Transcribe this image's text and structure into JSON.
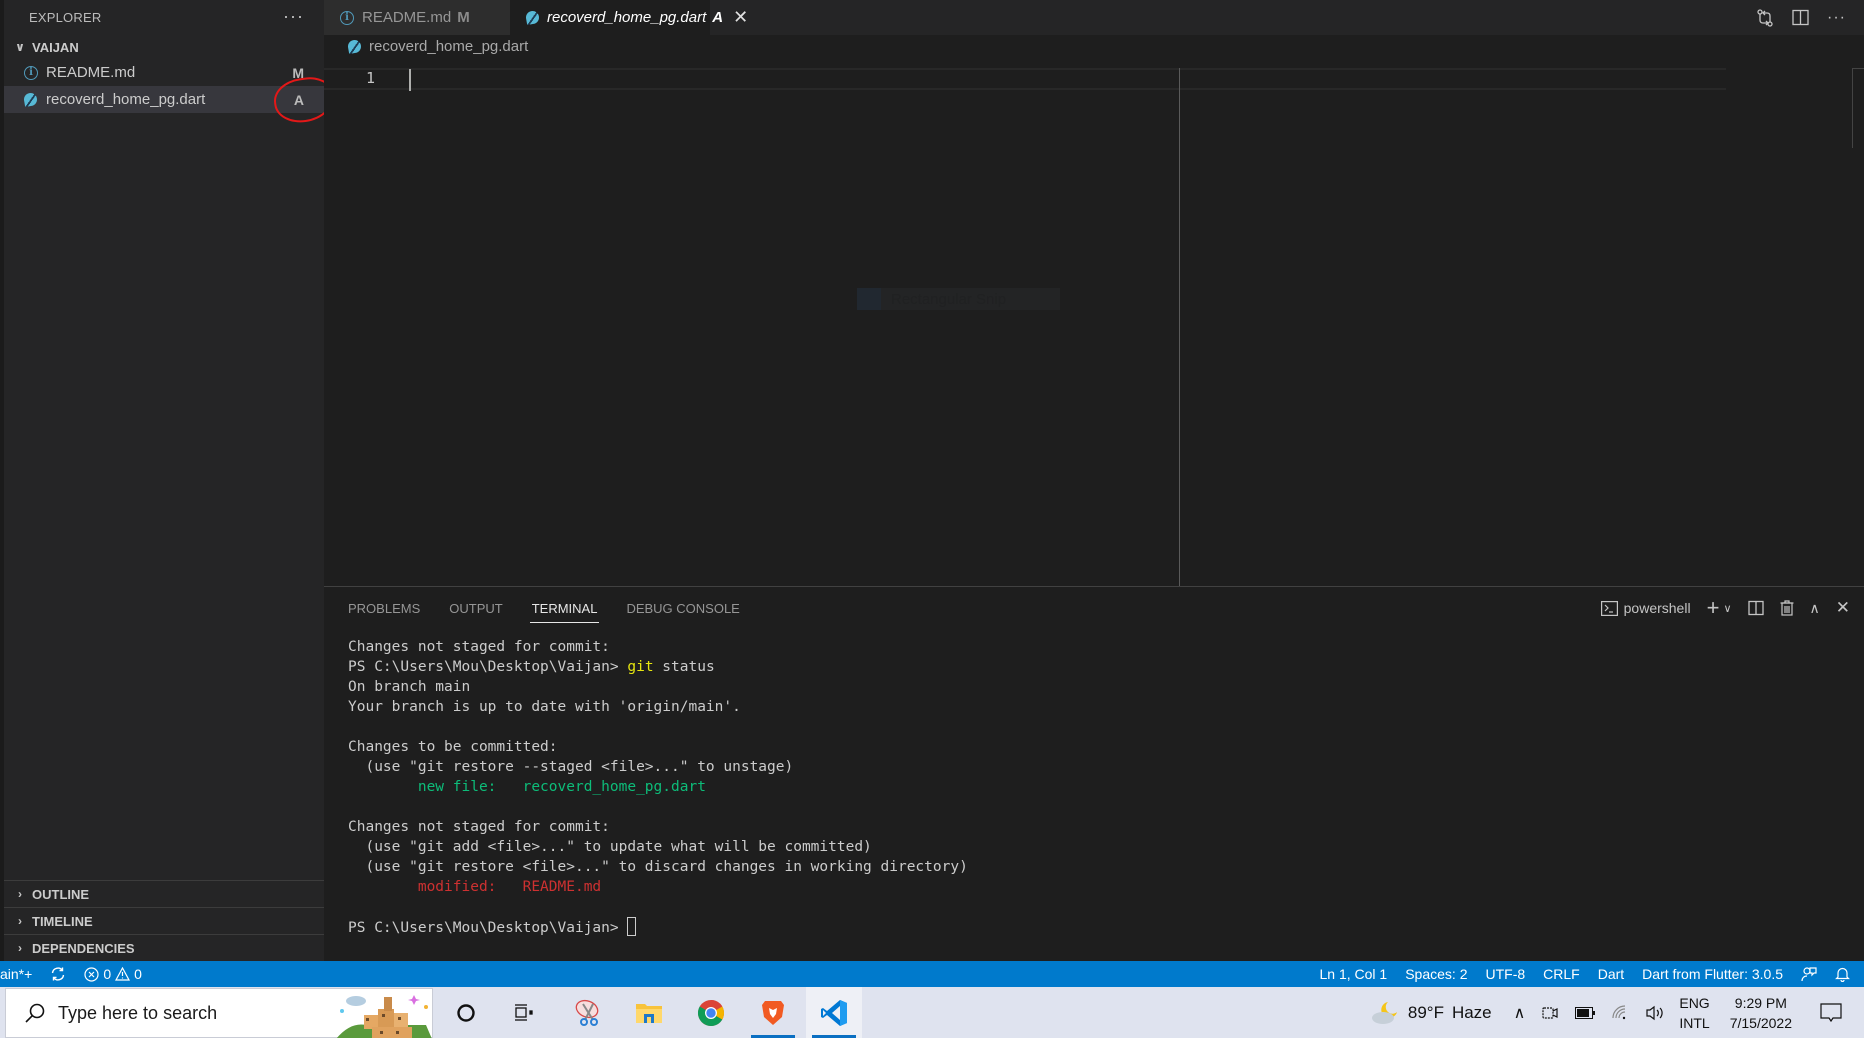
{
  "sidebar": {
    "title": "EXPLORER",
    "more_label": "···",
    "folder": "VAIJAN",
    "files": [
      {
        "name": "README.md",
        "badge": "M",
        "icon": "info-icon"
      },
      {
        "name": "recoverd_home_pg.dart",
        "badge": "A",
        "icon": "dart-icon",
        "selected": true
      }
    ],
    "sections": [
      "OUTLINE",
      "TIMELINE",
      "DEPENDENCIES"
    ]
  },
  "tabs": [
    {
      "label": "README.md",
      "badge": "M",
      "active": false
    },
    {
      "label": "recoverd_home_pg.dart",
      "badge": "A",
      "active": true,
      "close": "✕"
    }
  ],
  "editor": {
    "breadcrumb": "recoverd_home_pg.dart",
    "line_numbers": [
      "1"
    ],
    "ghost_overlay": "Rectangular Snip"
  },
  "panel": {
    "tabs": [
      "PROBLEMS",
      "OUTPUT",
      "TERMINAL",
      "DEBUG CONSOLE"
    ],
    "active_tab": "TERMINAL",
    "shell": "powershell",
    "terminal": {
      "l1": "Changes not staged for commit:",
      "prompt": "PS C:\\Users\\Mou\\Desktop\\Vaijan> ",
      "cmd_git": "git",
      "cmd_rest": " status",
      "l3": "On branch main",
      "l4": "Your branch is up to date with 'origin/main'.",
      "l6": "Changes to be committed:",
      "l7": "  (use \"git restore --staged <file>...\" to unstage)",
      "l8": "        new file:   recoverd_home_pg.dart",
      "l10": "Changes not staged for commit:",
      "l11": "  (use \"git add <file>...\" to update what will be committed)",
      "l12": "  (use \"git restore <file>...\" to discard changes in working directory)",
      "l13": "        modified:   README.md",
      "final_prompt": "PS C:\\Users\\Mou\\Desktop\\Vaijan> "
    }
  },
  "statusbar": {
    "branch": "ain*+",
    "errors": "0",
    "warnings": "0",
    "position": "Ln 1, Col 1",
    "spaces": "Spaces: 2",
    "encoding": "UTF-8",
    "eol": "CRLF",
    "language": "Dart",
    "sdk": "Dart from Flutter: 3.0.5"
  },
  "taskbar": {
    "search_placeholder": "Type here to search",
    "apps": [
      "cortana",
      "task-view",
      "snipping-tool",
      "file-explorer",
      "chrome",
      "brave",
      "vscode"
    ],
    "weather": {
      "temp": "89°F",
      "condition": "Haze"
    },
    "lang_top": "ENG",
    "lang_bottom": "INTL",
    "time": "9:29 PM",
    "date": "7/15/2022"
  }
}
